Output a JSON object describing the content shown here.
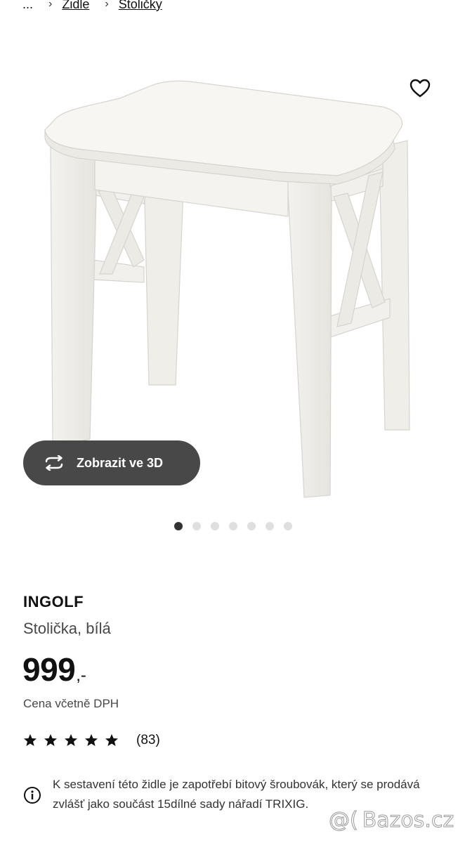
{
  "breadcrumb": {
    "ellipsis": "...",
    "items": [
      "Židle",
      "Stoličky"
    ]
  },
  "product": {
    "name": "INGOLF",
    "description": "Stolička, bílá",
    "price": "999",
    "price_suffix": ",-",
    "price_note": "Cena včetně DPH",
    "rating": {
      "stars": 5,
      "count_label": "(83)"
    },
    "info_text": "K sestavení této židle je zapotřebí bitový šroubovák, který se prodává zvlášť jako součást 15dílné sady nářadí TRIXIG."
  },
  "gallery": {
    "view_3d_label": "Zobrazit ve 3D",
    "image_count": 7,
    "active_index": 0
  },
  "icons": {
    "favourite": "heart-outline-icon",
    "view_3d": "rotate-3d-icon",
    "info": "info-circle-icon",
    "star": "star-icon"
  },
  "colors": {
    "button_dark": "#484848",
    "dot_active": "#333333",
    "dot_inactive": "#dfdfdf"
  },
  "watermark": {
    "text": "Bazos.cz"
  }
}
